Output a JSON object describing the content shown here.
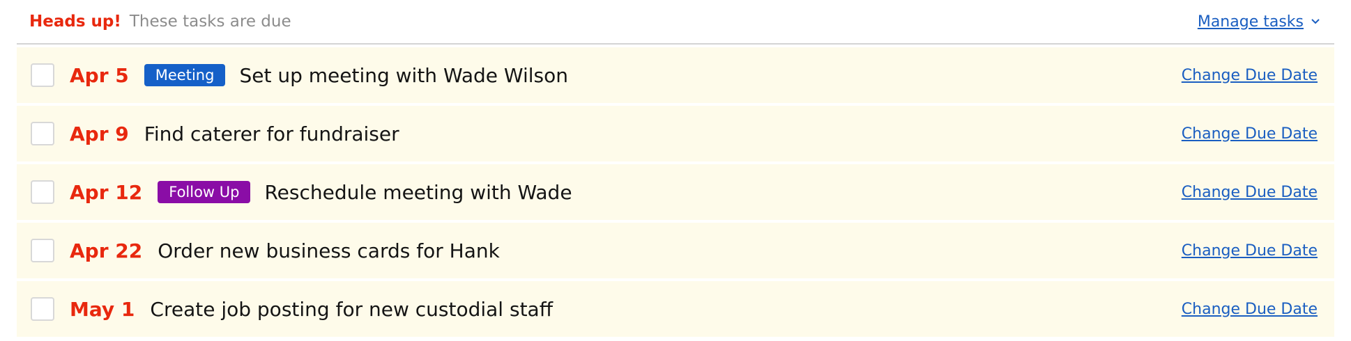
{
  "header": {
    "heads_up": "Heads up!",
    "subtitle": "These tasks are due",
    "manage_label": "Manage tasks",
    "manage_icon": "chevron-down-icon"
  },
  "colors": {
    "accent_red": "#e8280e",
    "link_blue": "#1a5ec1",
    "row_bg": "#fefbea"
  },
  "tasks": [
    {
      "date": "Apr 5",
      "tag": "Meeting",
      "tag_color": "#1560c8",
      "title": "Set up meeting with Wade Wilson",
      "action": "Change Due Date"
    },
    {
      "date": "Apr 9",
      "tag": "",
      "tag_color": "",
      "title": "Find caterer for fundraiser",
      "action": "Change Due Date"
    },
    {
      "date": "Apr 12",
      "tag": "Follow Up",
      "tag_color": "#8a0da6",
      "title": "Reschedule meeting with Wade",
      "action": "Change Due Date"
    },
    {
      "date": "Apr 22",
      "tag": "",
      "tag_color": "",
      "title": "Order new business cards for Hank",
      "action": "Change Due Date"
    },
    {
      "date": "May 1",
      "tag": "",
      "tag_color": "",
      "title": "Create job posting for new custodial staff",
      "action": "Change Due Date"
    }
  ]
}
